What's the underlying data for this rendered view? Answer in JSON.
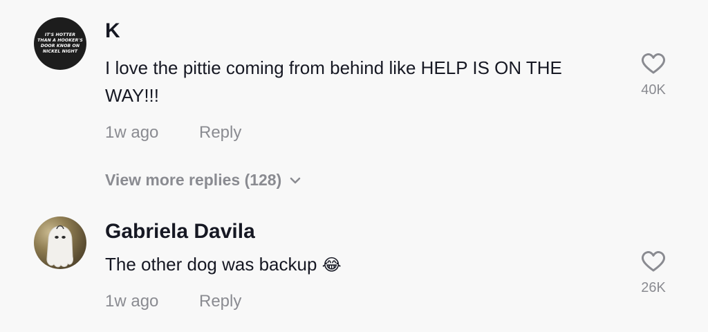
{
  "comments": [
    {
      "avatar_text": "IT'S HOTTER THAN A HOOKER'S DOOR KNOB ON NICKEL NIGHT",
      "username": "K",
      "text": "I love the pittie coming from behind like HELP IS ON THE WAY!!!",
      "time": "1w ago",
      "reply_label": "Reply",
      "likes": "40K",
      "like_icon": "heart-outline-icon",
      "view_more": "View more replies (128)",
      "view_more_icon": "chevron-down-icon"
    },
    {
      "avatar_desc_icon": "ghost-costume-avatar",
      "username": "Gabriela Davila",
      "text": "The other dog was backup",
      "emoji": "😂",
      "time": "1w ago",
      "reply_label": "Reply",
      "likes": "26K",
      "like_icon": "heart-outline-icon"
    }
  ],
  "colors": {
    "background": "#f8f8f8",
    "primary_text": "#161823",
    "secondary_text": "#8a8b91",
    "heart_stroke": "#8a8b91"
  }
}
